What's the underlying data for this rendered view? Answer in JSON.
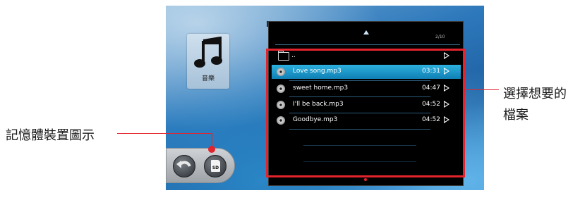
{
  "music_tile": {
    "label": "音樂",
    "icon": "music-note-icon"
  },
  "bottom_bar": {
    "back_icon": "back-arrow-icon",
    "storage_label": "SD"
  },
  "file_list": {
    "page_indicator": "2/10",
    "parent_folder": "..",
    "items": [
      {
        "name": "Love song.mp3",
        "duration": "03:31",
        "selected": true
      },
      {
        "name": "sweet home.mp3",
        "duration": "04:47",
        "selected": false
      },
      {
        "name": "I'll be back.mp3",
        "duration": "04:52",
        "selected": false
      },
      {
        "name": "Goodbye.mp3",
        "duration": "04:52",
        "selected": false
      }
    ]
  },
  "callouts": {
    "right_line1": "選擇想要的",
    "right_line2": "檔案",
    "left": "記憶體裝置圖示"
  },
  "colors": {
    "accent": "#e4232c",
    "selection": "#1aa0d0"
  }
}
